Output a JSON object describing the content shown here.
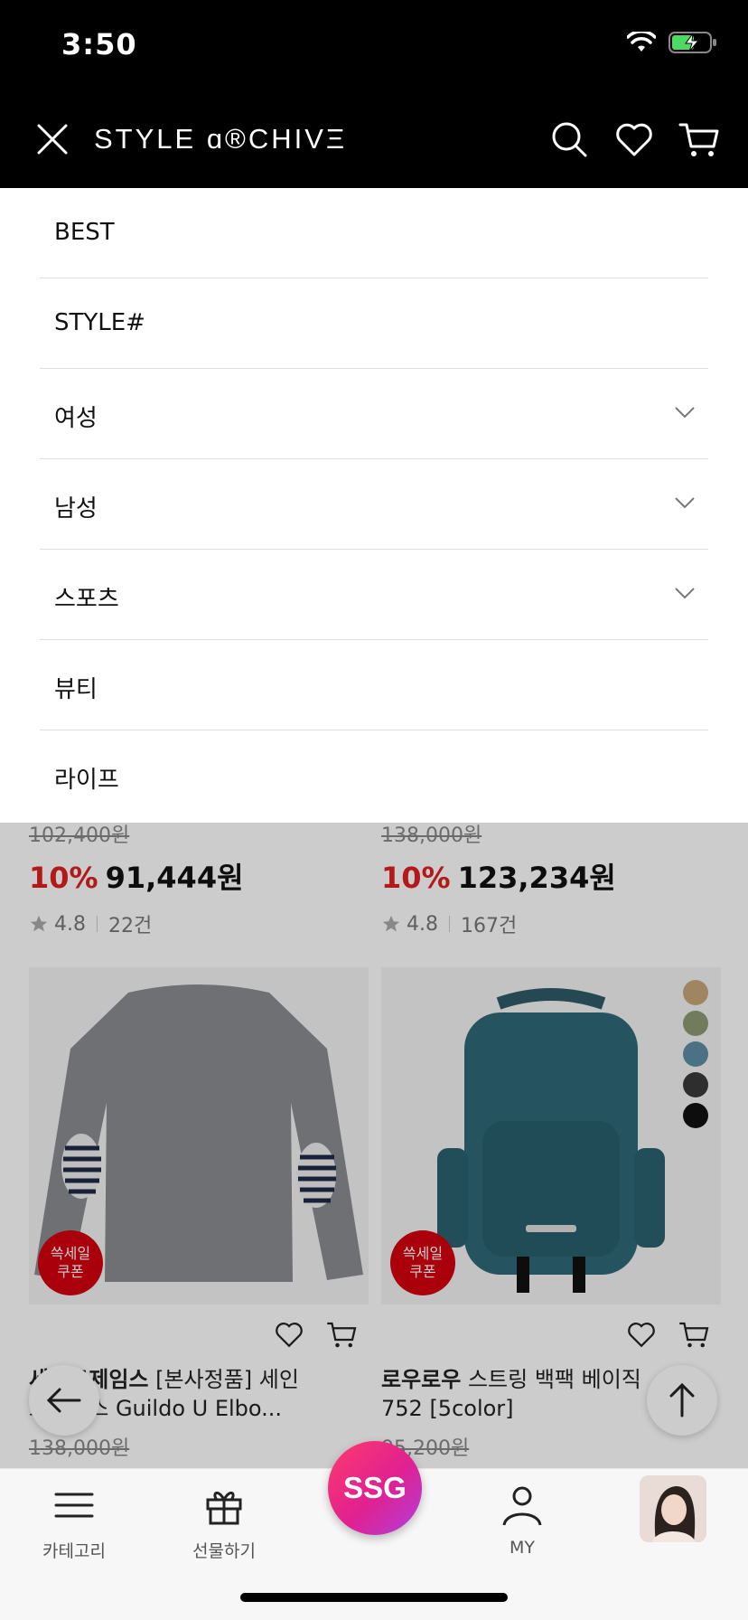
{
  "status_bar": {
    "time": "3:50"
  },
  "header": {
    "logo": "STYLE ɑ®CHIVΞ"
  },
  "menu": {
    "items": [
      {
        "label": "BEST",
        "has_chevron": false
      },
      {
        "label": "STYLE#",
        "has_chevron": false
      },
      {
        "label": "여성",
        "has_chevron": true
      },
      {
        "label": "남성",
        "has_chevron": true
      },
      {
        "label": "스포츠",
        "has_chevron": true
      },
      {
        "label": "뷰티",
        "has_chevron": false
      },
      {
        "label": "라이프",
        "has_chevron": false
      }
    ]
  },
  "products_top": [
    {
      "price_original": "102,400원",
      "discount": "10%",
      "price": "91,444원",
      "rating": "4.8",
      "reviews": "22건"
    },
    {
      "price_original": "138,000원",
      "discount": "10%",
      "price": "123,234원",
      "rating": "4.8",
      "reviews": "167건"
    }
  ],
  "products_bottom": [
    {
      "badge_line1": "쓱세일",
      "badge_line2": "쿠폰",
      "brand": "세인트제임스",
      "title": " [본사정품] 세인트제임스 Guildo U Elbo...",
      "price_original": "138,000원"
    },
    {
      "badge_line1": "쓱세일",
      "badge_line2": "쿠폰",
      "brand": "로우로우",
      "title": " 스트링 백팩 베이직 752 [5color]",
      "price_original": "95,200원"
    }
  ],
  "swatch_colors": [
    "#c8a878",
    "#8f9a72",
    "#5e8ea6",
    "#3a3a3a",
    "#111111"
  ],
  "tabbar": {
    "category": "카테고리",
    "gift": "선물하기",
    "ssg": "SSG",
    "my": "MY"
  },
  "colors": {
    "accent_red": "#e02020",
    "badge_red": "#d4000f"
  }
}
